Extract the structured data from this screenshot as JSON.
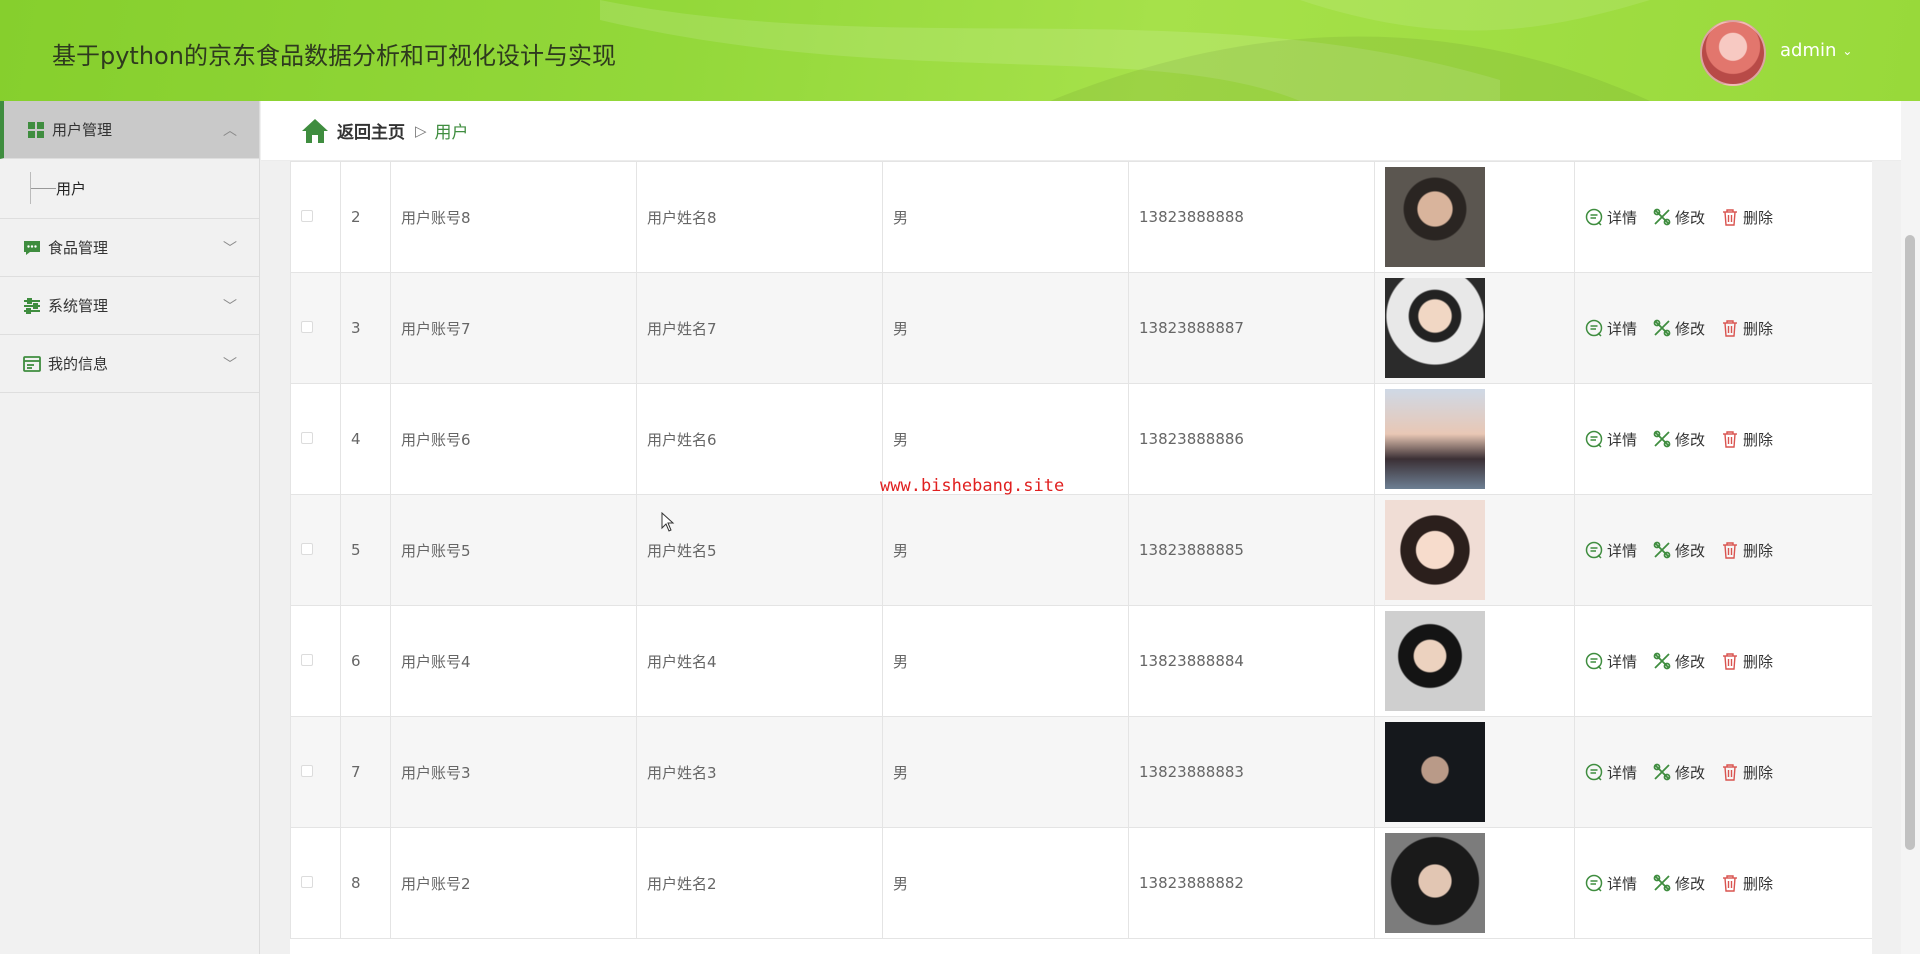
{
  "header": {
    "title": "基于python的京东食品数据分析和可视化设计与实现",
    "username": "admin"
  },
  "sidebar": {
    "items": [
      {
        "label": "用户管理",
        "icon": "grid-icon"
      },
      {
        "label": "食品管理",
        "icon": "chat-icon"
      },
      {
        "label": "系统管理",
        "icon": "sliders-icon"
      },
      {
        "label": "我的信息",
        "icon": "card-icon"
      }
    ],
    "submenu": {
      "label": "用户"
    }
  },
  "breadcrumb": {
    "home": "返回主页",
    "separator": "▷",
    "current": "用户"
  },
  "table": {
    "actions": {
      "detail": "详情",
      "edit": "修改",
      "delete": "删除"
    },
    "rows": [
      {
        "index": "2",
        "account": "用户账号8",
        "name": "用户姓名8",
        "gender": "男",
        "phone": "13823888888"
      },
      {
        "index": "3",
        "account": "用户账号7",
        "name": "用户姓名7",
        "gender": "男",
        "phone": "13823888887"
      },
      {
        "index": "4",
        "account": "用户账号6",
        "name": "用户姓名6",
        "gender": "男",
        "phone": "13823888886"
      },
      {
        "index": "5",
        "account": "用户账号5",
        "name": "用户姓名5",
        "gender": "男",
        "phone": "13823888885"
      },
      {
        "index": "6",
        "account": "用户账号4",
        "name": "用户姓名4",
        "gender": "男",
        "phone": "13823888884"
      },
      {
        "index": "7",
        "account": "用户账号3",
        "name": "用户姓名3",
        "gender": "男",
        "phone": "13823888883"
      },
      {
        "index": "8",
        "account": "用户账号2",
        "name": "用户姓名2",
        "gender": "男",
        "phone": "13823888882"
      }
    ]
  },
  "watermark": "www.bishebang.site",
  "colors": {
    "header_green": "#93d83a",
    "accent_green": "#3f8d3f",
    "delete_red": "#d9534f"
  }
}
